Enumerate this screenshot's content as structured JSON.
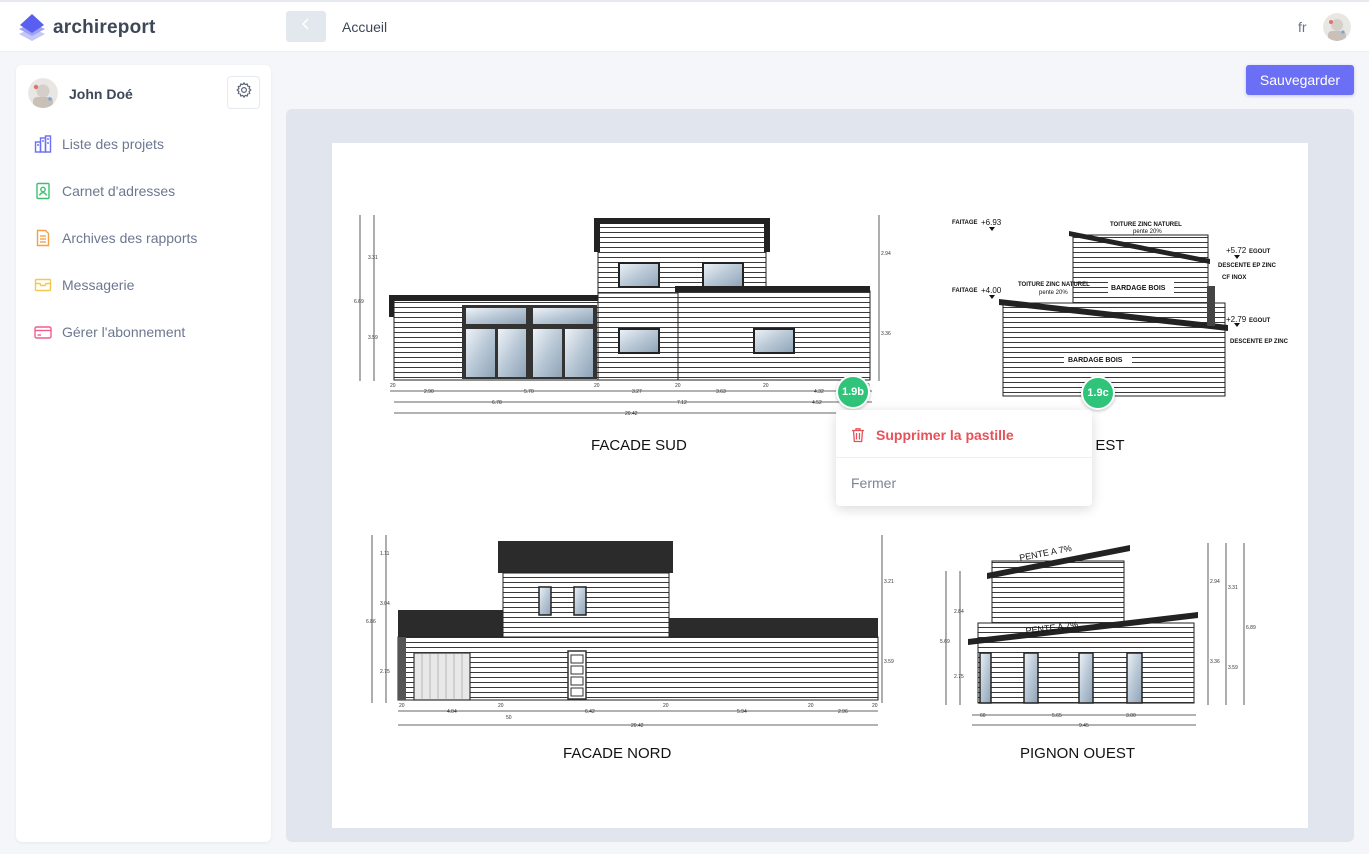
{
  "app": {
    "name": "archireport"
  },
  "header": {
    "breadcrumb": "Accueil",
    "language": "fr"
  },
  "user": {
    "name": "John Doé"
  },
  "sidebar": {
    "items": [
      {
        "label": "Liste des projets",
        "icon": "buildings-icon",
        "color": "#6a6ff3"
      },
      {
        "label": "Carnet d'adresses",
        "icon": "contact-card-icon",
        "color": "#3fbf6f"
      },
      {
        "label": "Archives des rapports",
        "icon": "document-icon",
        "color": "#f2a14a"
      },
      {
        "label": "Messagerie",
        "icon": "inbox-icon",
        "color": "#f2c94c"
      },
      {
        "label": "Gérer l'abonnement",
        "icon": "credit-card-icon",
        "color": "#ef5d8f"
      }
    ]
  },
  "toolbar": {
    "save_label": "Sauvegarder"
  },
  "colors": {
    "accent": "#6b6ff5",
    "pin": "#2fc479",
    "danger": "#e7525a"
  },
  "drawings": {
    "facade_sud": {
      "title": "FACADE SUD",
      "dims_row1": [
        "20",
        "2.90",
        "5.70",
        "20",
        "3.27",
        "20",
        "3.63",
        "20",
        "4.32",
        "20"
      ],
      "dims_row2": [
        "6.78",
        "7.12",
        "4.52"
      ],
      "dims_row3": [
        "20.42"
      ],
      "vertical_dims": [
        "3.31",
        "6.69",
        "3.59",
        "2.94",
        "3.36"
      ]
    },
    "pignon_est": {
      "title": "PIGNON EST",
      "labels": {
        "faitage_top": "FAITAGE",
        "faitage_top_val": "+6.93",
        "faitage_low": "FAITAGE",
        "faitage_low_val": "+4.00",
        "toiture_top": "TOITURE ZINC NATUREL",
        "pente_top": "pente 20%",
        "toiture_low": "TOITURE ZINC NATUREL",
        "pente_low": "pente 20%",
        "bardage_top": "BARDAGE BOIS",
        "bardage_low": "BARDAGE BOIS",
        "egout_high": "+5.72",
        "egout_high_label": "EGOUT",
        "descente_1": "DESCENTE EP ZINC",
        "cf_inox": "CF INOX",
        "egout_low": "+2.79",
        "egout_low_label": "EGOUT",
        "descente_2": "DESCENTE EP ZINC"
      }
    },
    "facade_nord": {
      "title": "FACADE NORD",
      "dims_row1": [
        "20",
        "4.04",
        "20",
        "50",
        "6.42",
        "20",
        "5.94",
        "20",
        "2.96",
        "20"
      ],
      "dims_row2": [
        "20.42"
      ],
      "vertical_dims": [
        "1.11",
        "3.04",
        "6.86",
        "2.75",
        "3.21",
        "3.59"
      ]
    },
    "pignon_ouest": {
      "title": "PIGNON OUEST",
      "pente_top": "PENTE A 7%",
      "pente_low": "PENTE A 7%",
      "dims_row1": [
        "60",
        "5.65",
        "3.00"
      ],
      "dims_row2": [
        "9.45"
      ],
      "vertical_dims": [
        "2.84",
        "5.69",
        "2.75",
        "2.94",
        "3.36",
        "3.31",
        "3.59",
        "6.89"
      ]
    }
  },
  "pins": [
    {
      "label": "1.9b"
    },
    {
      "label": "1.9c"
    }
  ],
  "popup": {
    "delete_label": "Supprimer la pastille",
    "close_label": "Fermer"
  }
}
